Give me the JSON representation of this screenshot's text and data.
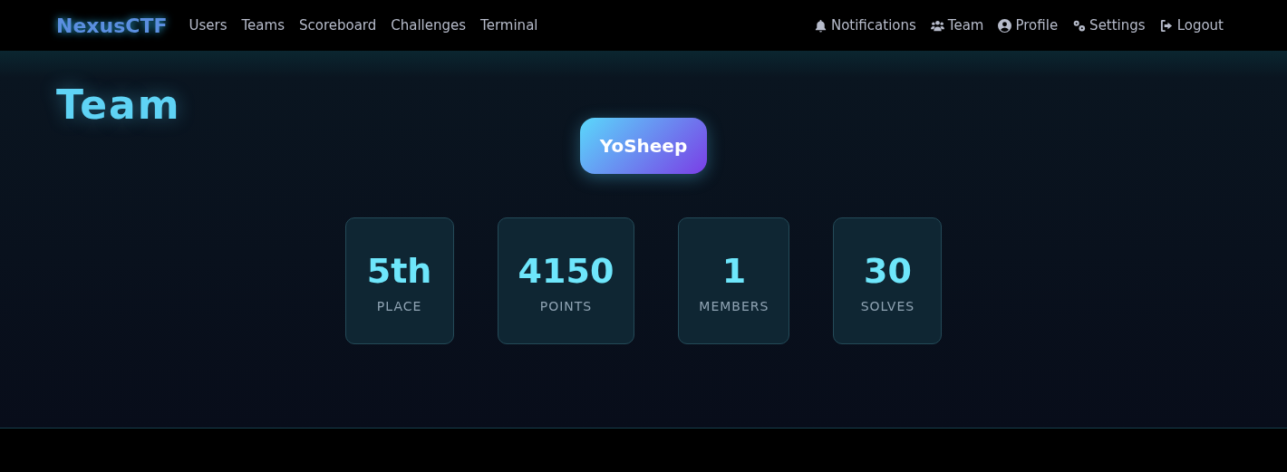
{
  "navbar": {
    "brand": "NexusCTF",
    "left_links": [
      "Users",
      "Teams",
      "Scoreboard",
      "Challenges",
      "Terminal"
    ],
    "right_links": [
      "Notifications",
      "Team",
      "Profile",
      "Settings",
      "Logout"
    ]
  },
  "page": {
    "title": "Team",
    "team_name": "YoSheep",
    "stats": [
      {
        "value": "5th",
        "label": "PLACE"
      },
      {
        "value": "4150",
        "label": "POINTS"
      },
      {
        "value": "1",
        "label": "MEMBERS"
      },
      {
        "value": "30",
        "label": "SOLVES"
      }
    ]
  }
}
